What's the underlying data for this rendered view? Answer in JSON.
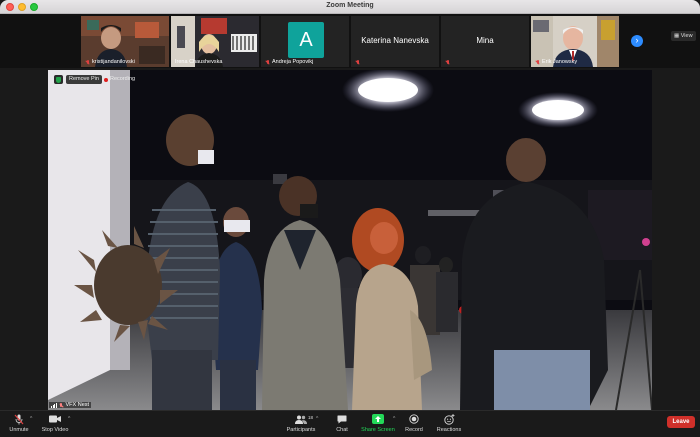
{
  "window": {
    "title": "Zoom Meeting"
  },
  "gallery": {
    "participants": [
      {
        "name": "kristijandanilovski",
        "muted": true
      },
      {
        "name": "Irena Chaushevska",
        "muted": false
      },
      {
        "name": "Andreja Popovikj",
        "muted": true,
        "avatar_letter": "A",
        "avatar_color": "#0fa39b"
      },
      {
        "name": "Katerina Nanevska",
        "muted": true
      },
      {
        "name": "Mina",
        "muted": true
      },
      {
        "name": "Erik Janowsky",
        "muted": true
      }
    ],
    "next_icon": "chevron-right-icon",
    "next_glyph": "›",
    "view_label": "View"
  },
  "main_video": {
    "remove_pin_label": "Remove Pin",
    "recording_label": "Recording",
    "participant_name": "VFX Nest"
  },
  "toolbar": {
    "unmute_label": "Unmute",
    "stop_video_label": "Stop Video",
    "participants_label": "Participants",
    "participants_count": "18",
    "chat_label": "Chat",
    "share_screen_label": "Share Screen",
    "record_label": "Record",
    "reactions_label": "Reactions",
    "leave_label": "Leave"
  },
  "colors": {
    "accent": "#2d8cff",
    "share_green": "#23d959",
    "leave_red": "#d0302a",
    "muted_red": "#e04040"
  }
}
